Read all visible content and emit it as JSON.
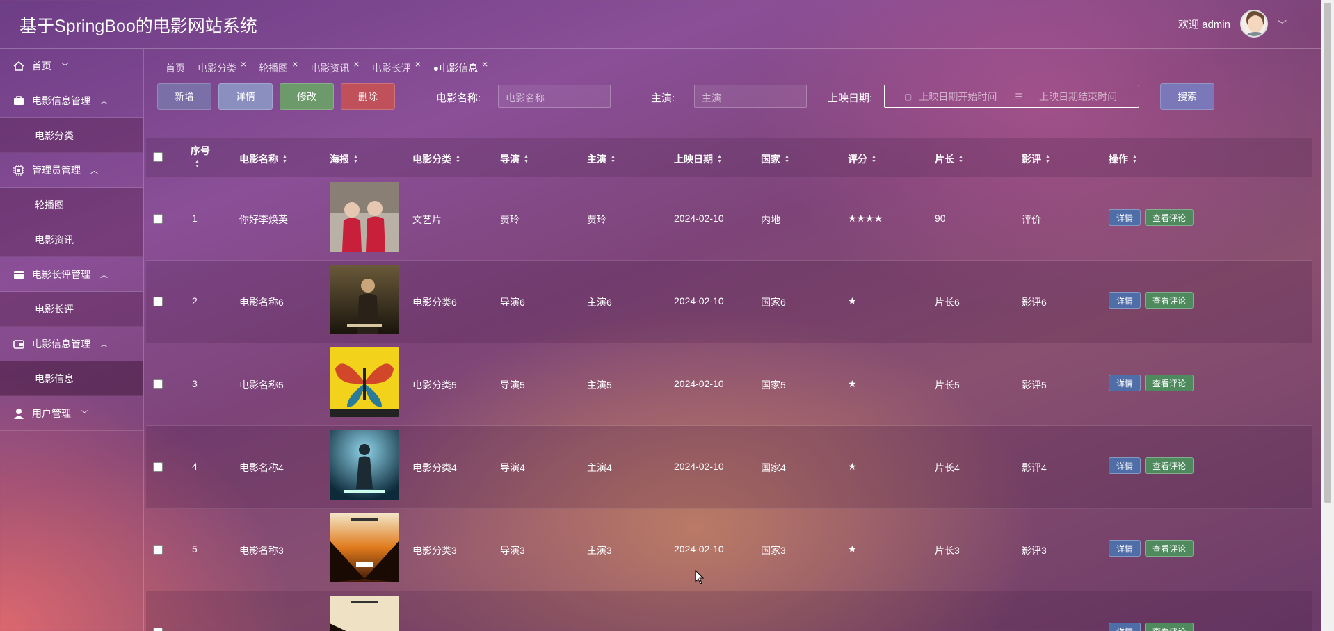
{
  "app": {
    "title": "基于SpringBoo的电影网站系统",
    "welcome": "欢迎 admin"
  },
  "sidebar": {
    "home": "首页",
    "g1": {
      "label": "电影信息管理",
      "sub": "电影分类"
    },
    "g2": {
      "label": "管理员管理",
      "subs": [
        "轮播图",
        "电影资讯"
      ]
    },
    "g3": {
      "label": "电影长评管理",
      "sub": "电影长评"
    },
    "g4": {
      "label": "电影信息管理",
      "sub": "电影信息"
    },
    "g5": {
      "label": "用户管理"
    }
  },
  "tabs": [
    "首页",
    "电影分类",
    "轮播图",
    "电影资讯",
    "电影长评",
    "●电影信息"
  ],
  "toolbar": {
    "add": "新增",
    "detail": "详情",
    "edit": "修改",
    "delete": "删除",
    "search": "搜索",
    "name_label": "电影名称:",
    "name_ph": "电影名称",
    "actor_label": "主演:",
    "actor_ph": "主演",
    "date_label": "上映日期:",
    "date_start": "上映日期开始时间",
    "date_end": "上映日期结束时间"
  },
  "columns": [
    "序号",
    "电影名称",
    "海报",
    "电影分类",
    "导演",
    "主演",
    "上映日期",
    "国家",
    "评分",
    "片长",
    "影评",
    "操作"
  ],
  "rows": [
    {
      "id": "1",
      "name": "你好李焕英",
      "category": "文艺片",
      "director": "贾玲",
      "actor": "贾玲",
      "date": "2024-02-10",
      "country": "内地",
      "rating": "★★★★",
      "length": "90",
      "review": "评价"
    },
    {
      "id": "2",
      "name": "电影名称6",
      "category": "电影分类6",
      "director": "导演6",
      "actor": "主演6",
      "date": "2024-02-10",
      "country": "国家6",
      "rating": "★",
      "length": "片长6",
      "review": "影评6"
    },
    {
      "id": "3",
      "name": "电影名称5",
      "category": "电影分类5",
      "director": "导演5",
      "actor": "主演5",
      "date": "2024-02-10",
      "country": "国家5",
      "rating": "★",
      "length": "片长5",
      "review": "影评5"
    },
    {
      "id": "4",
      "name": "电影名称4",
      "category": "电影分类4",
      "director": "导演4",
      "actor": "主演4",
      "date": "2024-02-10",
      "country": "国家4",
      "rating": "★",
      "length": "片长4",
      "review": "影评4"
    },
    {
      "id": "5",
      "name": "电影名称3",
      "category": "电影分类3",
      "director": "导演3",
      "actor": "主演3",
      "date": "2024-02-10",
      "country": "国家3",
      "rating": "★",
      "length": "片长3",
      "review": "影评3"
    }
  ],
  "row_actions": {
    "detail": "详情",
    "comments": "查看评论"
  }
}
